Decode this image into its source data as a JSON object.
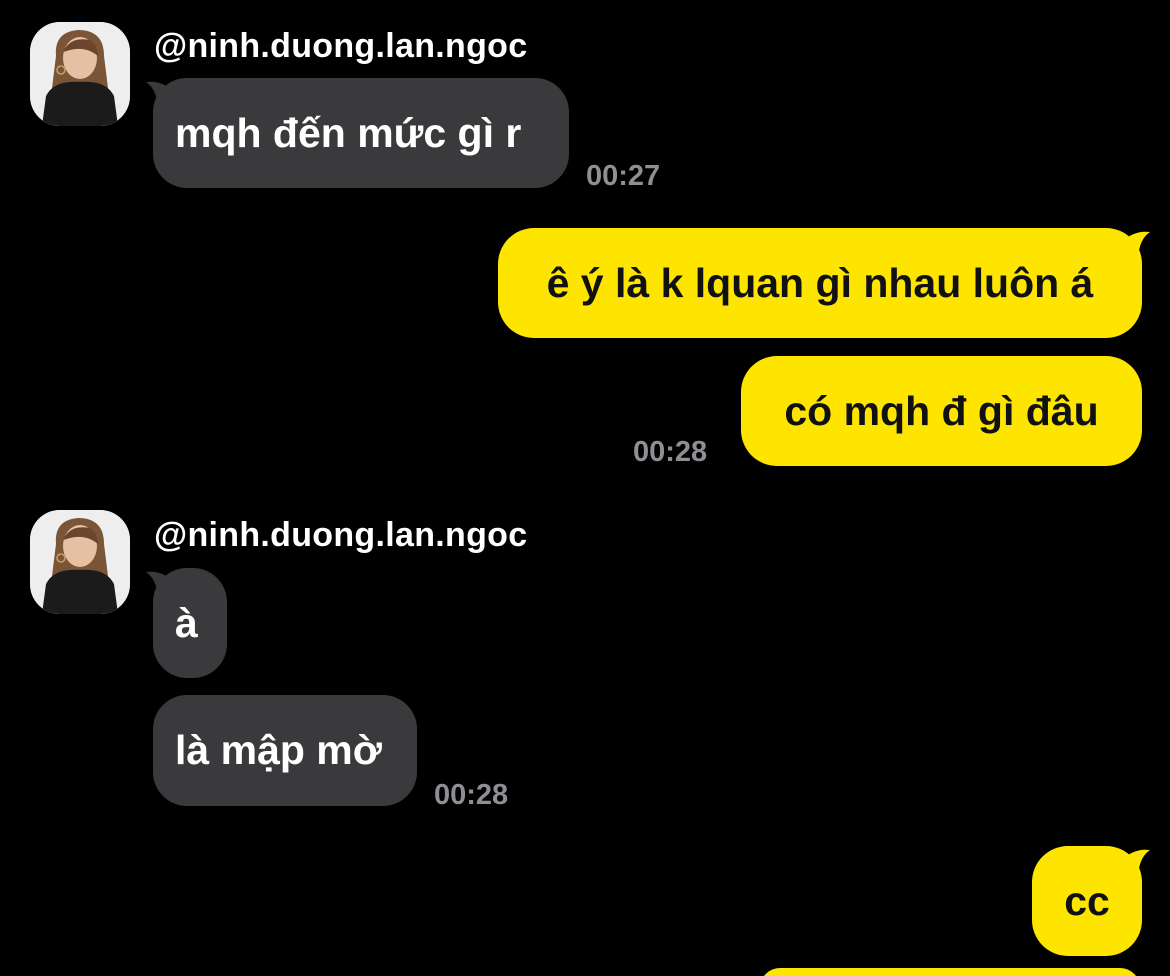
{
  "conversation": {
    "groups": [
      {
        "sender": "@ninh.duong.lan.ngoc",
        "messages": [
          {
            "text": "mqh đến mức gì r",
            "time": "00:27"
          }
        ]
      },
      {
        "sender": "me",
        "messages": [
          {
            "text": "ê ý là k lquan gì nhau luôn á"
          },
          {
            "text": "có mqh đ gì đâu",
            "time": "00:28"
          }
        ]
      },
      {
        "sender": "@ninh.duong.lan.ngoc",
        "messages": [
          {
            "text": "à"
          },
          {
            "text": "là mập mờ",
            "time": "00:28"
          }
        ]
      },
      {
        "sender": "me",
        "messages": [
          {
            "text": "cc"
          }
        ]
      }
    ]
  },
  "icons": {
    "avatar": "profile-photo-icon"
  },
  "colors": {
    "background": "#000000",
    "incoming_bubble": "#3a3a3c",
    "outgoing_bubble": "#fde500",
    "timestamp": "#8e8e93",
    "text_light": "#ffffff",
    "text_dark": "#111111"
  }
}
